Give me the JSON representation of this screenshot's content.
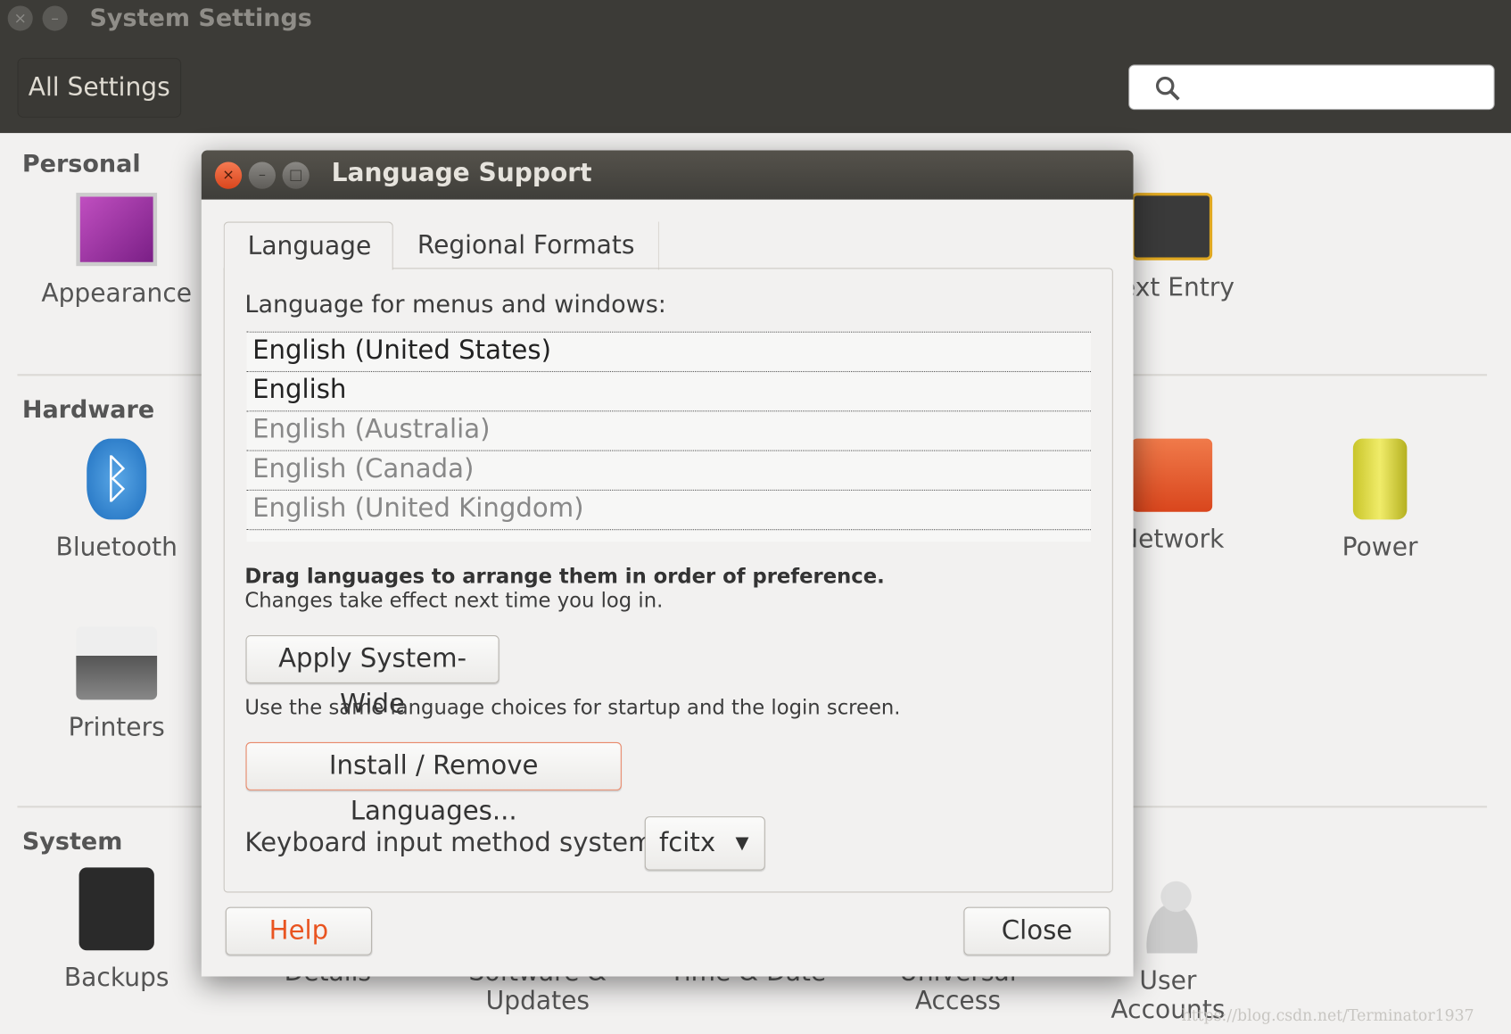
{
  "window": {
    "title": "System Settings",
    "all_settings": "All Settings",
    "search_placeholder": ""
  },
  "sections": {
    "personal": "Personal",
    "hardware": "Hardware",
    "system": "System"
  },
  "items": {
    "appearance": "Appearance",
    "text_entry": "Text Entry",
    "bluetooth": "Bluetooth",
    "network": "Network",
    "power": "Power",
    "printers": "Printers",
    "backups": "Backups",
    "details": "Details",
    "software": "Software &",
    "software2": "Updates",
    "time": "Time & Date",
    "universal": "Universal",
    "universal2": "Access",
    "user": "User",
    "user2": "Accounts"
  },
  "dialog": {
    "title": "Language Support",
    "tabs": [
      "Language",
      "Regional Formats"
    ],
    "list_label": "Language for menus and windows:",
    "languages": [
      "English (United States)",
      "English",
      "English (Australia)",
      "English (Canada)",
      "English (United Kingdom)"
    ],
    "drag_hint": "Drag languages to arrange them in order of preference.",
    "changes_hint": "Changes take effect next time you log in.",
    "apply_button": "Apply System-Wide",
    "apply_hint": "Use the same language choices for startup and the login screen.",
    "install_button": "Install / Remove Languages...",
    "keyboard_label": "Keyboard input method system:",
    "keyboard_value": "fcitx",
    "help_button": "Help",
    "close_button": "Close"
  },
  "colors": {
    "accent": "#e95420",
    "titlebar": "#3c3b37"
  },
  "watermark": "https://blog.csdn.net/Terminator1937"
}
